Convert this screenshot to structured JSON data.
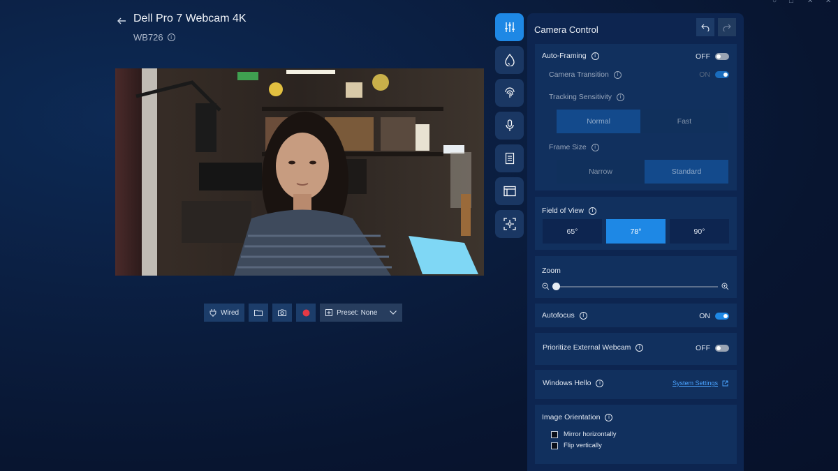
{
  "header": {
    "title": "Dell Pro 7 Webcam 4K",
    "model": "WB726"
  },
  "toolbar": {
    "connection_label": "Wired",
    "preset_label": "Preset: None"
  },
  "panel": {
    "title": "Camera Control",
    "auto_framing": {
      "label": "Auto-Framing",
      "state": "OFF",
      "camera_transition": {
        "label": "Camera Transition",
        "state": "ON"
      },
      "tracking_sensitivity": {
        "label": "Tracking Sensitivity",
        "options": [
          "Normal",
          "Fast"
        ],
        "selected": "Normal"
      },
      "frame_size": {
        "label": "Frame Size",
        "options": [
          "Narrow",
          "Standard"
        ],
        "selected": "Standard"
      }
    },
    "field_of_view": {
      "label": "Field of View",
      "options": [
        "65°",
        "78°",
        "90°"
      ],
      "selected": "78°"
    },
    "zoom": {
      "label": "Zoom",
      "value": 0
    },
    "autofocus": {
      "label": "Autofocus",
      "state": "ON"
    },
    "prioritize_external": {
      "label": "Prioritize External Webcam",
      "state": "OFF"
    },
    "windows_hello": {
      "label": "Windows Hello",
      "link": "System Settings"
    },
    "image_orientation": {
      "label": "Image Orientation",
      "mirror": "Mirror horizontally",
      "flip": "Flip vertically"
    }
  },
  "colors": {
    "accent": "#1e88e5",
    "background": "#0b1f42",
    "panel": "#0d2550",
    "card": "#11305e",
    "record": "#e53945"
  }
}
